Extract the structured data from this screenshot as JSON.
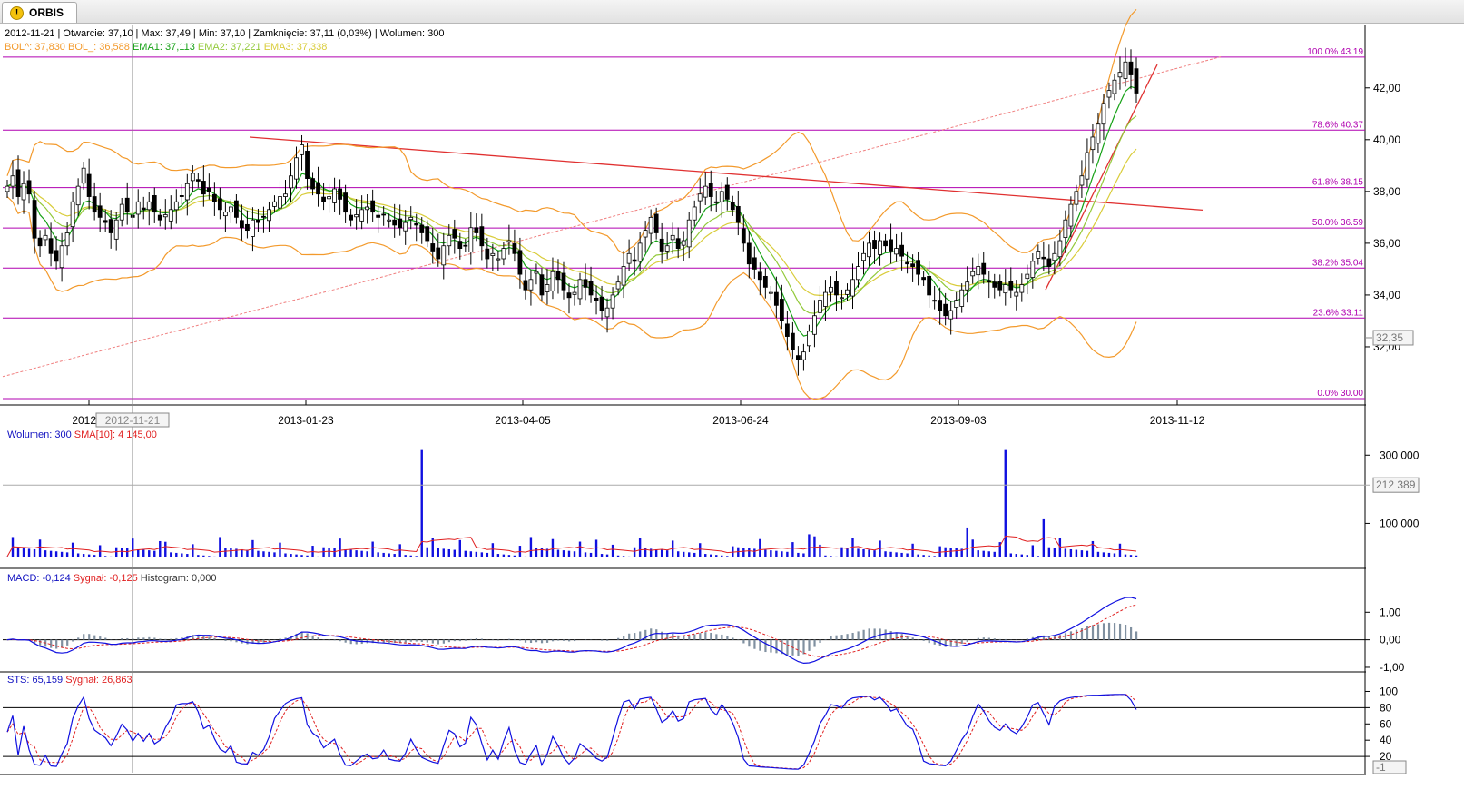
{
  "app": {
    "tab_label": "ORBIS",
    "tab_icon": "warning-icon"
  },
  "price_info": {
    "line1": "2012-11-21 | Otwarcie: 37,10 | Max: 37,49 | Min: 37,10 | Zamknięcie: 37,11 (0,03%)  | Wolumen: 300",
    "bol_up": "BOL^: 37,830",
    "bol_low": "BOL_: 36,588",
    "ema1": "EMA1: 37,113",
    "ema2": "EMA2: 37,221",
    "ema3": "EMA3: 37,338"
  },
  "volume_info": {
    "vol": "Wolumen: 300",
    "sma": "SMA[10]: 4 145,00"
  },
  "macd_info": {
    "macd": "MACD: -0,124",
    "signal": "Sygnał: -0,125",
    "hist": "Histogram: 0,000"
  },
  "sts_info": {
    "sts": "STS: 65,159",
    "signal": "Sygnał: 26,863"
  },
  "cursor_date": "2012-11-21",
  "price_marker": "32,35",
  "volume_marker": "212 389",
  "sts_marker": "-1",
  "colors": {
    "bol": "#f39a2c",
    "ema1": "#15a115",
    "ema2": "#93c93a",
    "ema3": "#d9cc3a",
    "fib": "#b000b0",
    "trend": "#e03030",
    "volume": "#1010e0",
    "sma": "#e02020",
    "macd": "#1010e0",
    "signal": "#e02020",
    "hist": "#8090a0"
  },
  "chart_data": [
    {
      "type": "candlestick",
      "x_ticks": [
        "2012-1",
        "2013-01-23",
        "2013-04-05",
        "2013-06-24",
        "2013-09-03",
        "2013-11-12"
      ],
      "y_ticks": [
        "42,00",
        "40,00",
        "38,00",
        "36,00",
        "34,00",
        "32,00"
      ],
      "ylim": [
        30,
        43.5
      ],
      "fib_levels": [
        {
          "label": "100.0% 43.19",
          "value": 43.19
        },
        {
          "label": "78.6% 40.37",
          "value": 40.37
        },
        {
          "label": "61.8% 38.15",
          "value": 38.15
        },
        {
          "label": "50.0% 36.59",
          "value": 36.59
        },
        {
          "label": "38.2% 35.04",
          "value": 35.04
        },
        {
          "label": "23.6% 33.11",
          "value": 33.11
        },
        {
          "label": "0.0% 30.00",
          "value": 30.0
        }
      ],
      "close": [
        38.2,
        38.6,
        37.8,
        38.3,
        37.9,
        36.2,
        35.9,
        36.3,
        35.6,
        35.3,
        35.9,
        36.4,
        37.6,
        38.2,
        38.9,
        37.8,
        37.2,
        37.0,
        36.8,
        36.4,
        36.9,
        37.5,
        37.2,
        37.0,
        37.6,
        37.3,
        37.6,
        37.2,
        36.9,
        37.1,
        37.3,
        37.6,
        37.8,
        38.3,
        38.7,
        38.4,
        37.9,
        38.0,
        37.6,
        37.3,
        37.2,
        37.4,
        37.0,
        36.6,
        36.5,
        36.9,
        36.8,
        37.0,
        37.3,
        37.6,
        37.8,
        37.9,
        38.6,
        39.3,
        39.8,
        38.5,
        38.1,
        37.9,
        37.6,
        37.8,
        38.1,
        37.7,
        37.2,
        36.9,
        37.1,
        37.3,
        37.4,
        37.2,
        37.0,
        37.1,
        36.9,
        36.7,
        36.6,
        36.8,
        37.0,
        36.7,
        36.4,
        36.1,
        35.7,
        35.4,
        35.9,
        36.3,
        36.2,
        35.8,
        35.9,
        36.6,
        36.4,
        35.9,
        35.4,
        35.6,
        35.4,
        35.8,
        36.1,
        35.6,
        34.8,
        34.2,
        34.6,
        34.9,
        34.0,
        34.4,
        34.9,
        34.6,
        34.2,
        33.9,
        34.1,
        34.6,
        34.3,
        34.0,
        33.8,
        33.4,
        33.5,
        34.0,
        34.5,
        35.1,
        35.6,
        35.3,
        36.0,
        36.5,
        37.0,
        36.4,
        35.7,
        35.9,
        36.3,
        35.8,
        36.1,
        36.9,
        37.4,
        37.9,
        38.2,
        37.8,
        37.6,
        38.0,
        37.7,
        37.3,
        36.8,
        36.0,
        35.2,
        35.0,
        34.6,
        34.3,
        34.1,
        33.6,
        33.0,
        32.4,
        31.9,
        31.5,
        31.8,
        32.6,
        33.2,
        33.8,
        34.1,
        34.3,
        34.0,
        33.9,
        34.2,
        34.6,
        35.1,
        35.6,
        36.0,
        35.8,
        36.1,
        35.9,
        35.7,
        35.8,
        35.5,
        35.2,
        35.1,
        34.8,
        34.6,
        34.0,
        33.8,
        33.4,
        33.2,
        33.4,
        33.8,
        34.2,
        34.5,
        34.9,
        35.1,
        34.8,
        34.5,
        34.3,
        34.2,
        34.4,
        34.2,
        34.1,
        34.4,
        34.8,
        35.3,
        35.7,
        35.4,
        35.1,
        35.6,
        36.1,
        36.9,
        37.5,
        38.0,
        38.6,
        39.5,
        40.1,
        40.6,
        41.4,
        41.9,
        42.3,
        42.6,
        43.0,
        42.5,
        41.8
      ],
      "volume_ticks": [
        "300 000",
        "100 000"
      ],
      "volume_ylim": [
        0,
        330000
      ],
      "macd_ticks": [
        "1,00",
        "0,00",
        "-1,00"
      ],
      "macd_ylim": [
        -1.1,
        1.9
      ],
      "sts_ticks": [
        "100",
        "80",
        "60",
        "40",
        "20"
      ],
      "sts_ylim": [
        0,
        105
      ]
    }
  ]
}
